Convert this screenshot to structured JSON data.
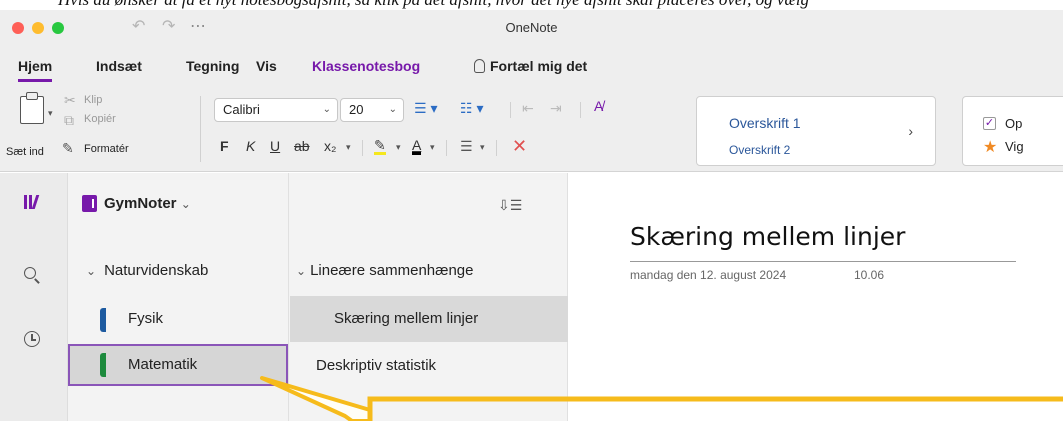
{
  "window": {
    "title": "OneNote"
  },
  "caption_fragment": "Hvis du ønsker at få et nyt notesbogsafsnit, så klik på det afsnit, hvor det nye afsnit skal placeres over, og vælg",
  "ribbon_tabs": [
    "Hjem",
    "Indsæt",
    "Tegning",
    "Vis",
    "Klassenotesbog",
    "Fortæl mig det"
  ],
  "clipboard": {
    "paste_label": "Sæt ind",
    "cut": "Klip",
    "copy": "Kopiér",
    "format": "Formatér"
  },
  "font": {
    "name": "Calibri",
    "size": "20"
  },
  "format_buttons": [
    "F",
    "K",
    "U",
    "ab",
    "x₂"
  ],
  "styles": {
    "heading1": "Overskrift 1",
    "heading2": "Overskrift 2"
  },
  "tags": {
    "todo": "Op",
    "important": "Vig"
  },
  "notebook": {
    "name": "GymNoter"
  },
  "sections": {
    "group": "Naturvidenskab",
    "items": [
      {
        "label": "Fysik",
        "color": "#1d5aa0"
      },
      {
        "label": "Matematik",
        "color": "#1d8a3d"
      }
    ]
  },
  "pages": {
    "group": "Lineære sammenhænge",
    "items": [
      "Skæring mellem linjer",
      "Deskriptiv statistik"
    ]
  },
  "note": {
    "title": "Skæring mellem linjer",
    "date": "mandag den 12. august 2024",
    "time": "10.06"
  },
  "colors": {
    "accent": "#7719aa",
    "callout": "#f6bb1b"
  }
}
